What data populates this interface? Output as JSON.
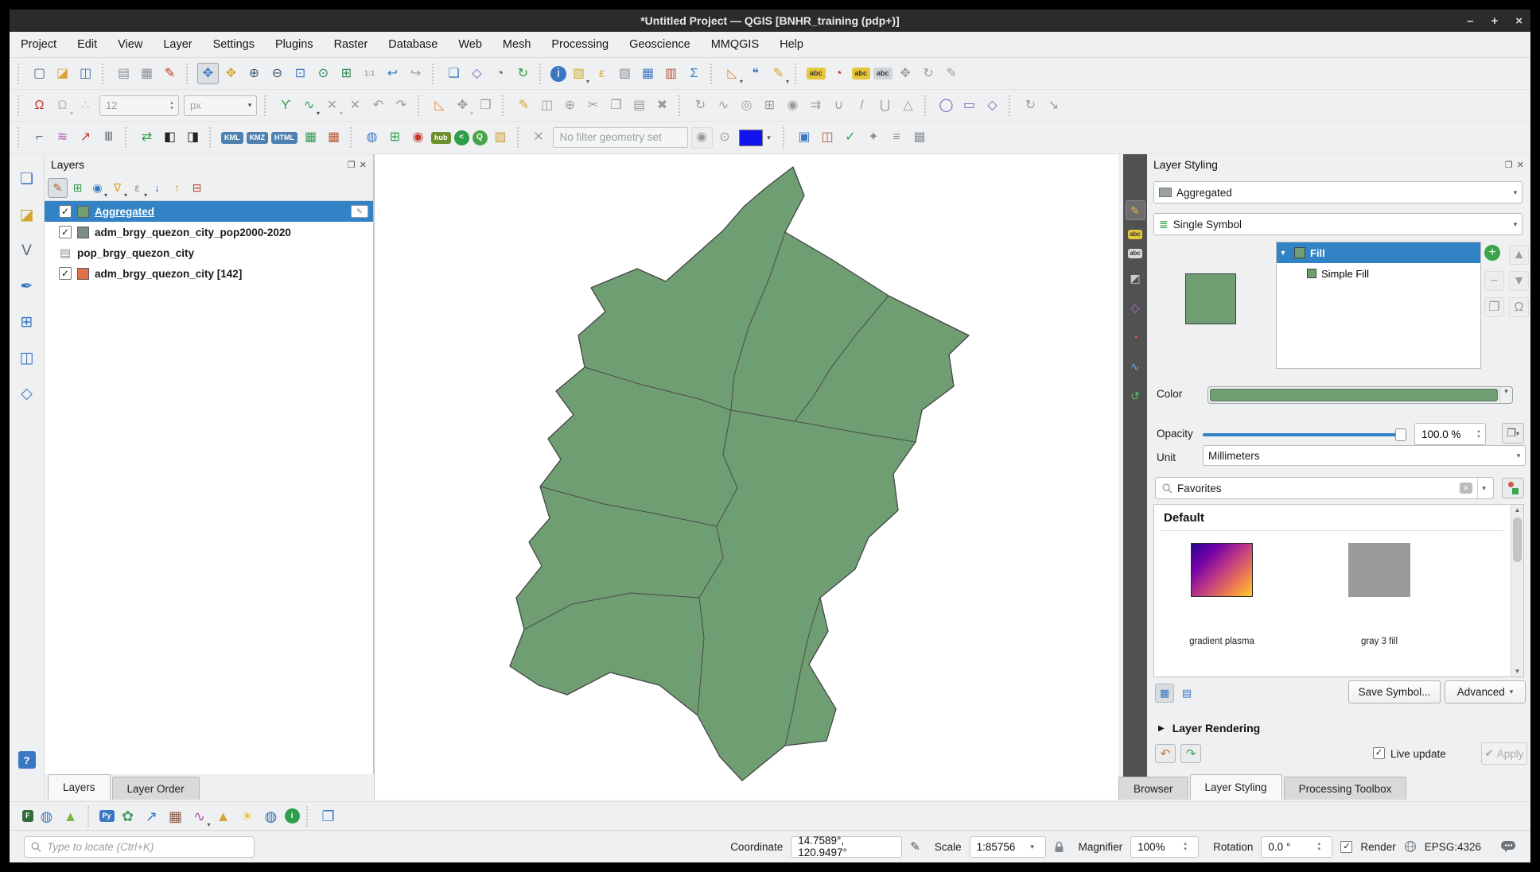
{
  "window": {
    "title": "*Untitled Project — QGIS [BNHR_training (pdp+)]",
    "controls": [
      {
        "n": "minimize-button",
        "g": "–"
      },
      {
        "n": "maximize-button",
        "g": "+"
      },
      {
        "n": "close-button",
        "g": "×"
      }
    ]
  },
  "menubar": {
    "items": [
      "Project",
      "Edit",
      "View",
      "Layer",
      "Settings",
      "Plugins",
      "Raster",
      "Database",
      "Web",
      "Mesh",
      "Processing",
      "Geoscience",
      "MMQGIS",
      "Help"
    ]
  },
  "toolbars": {
    "row1": [
      {
        "t": "sep",
        "n": "toolbar-handle"
      },
      {
        "n": "new-project-icon",
        "g": "▢",
        "c": "#5b6770"
      },
      {
        "n": "open-project-icon",
        "g": "◪",
        "c": "#d9a33c"
      },
      {
        "n": "save-project-icon",
        "g": "◫",
        "c": "#3a6fae"
      },
      {
        "t": "sep",
        "n": "toolbar-separator"
      },
      {
        "n": "new-print-layout-icon",
        "g": "▤",
        "c": "#8a9096"
      },
      {
        "n": "layout-manager-icon",
        "g": "▦",
        "c": "#8a9096"
      },
      {
        "n": "style-manager-icon",
        "g": "✎",
        "c": "#c0392b"
      },
      {
        "t": "sep",
        "n": "toolbar-separator"
      },
      {
        "n": "pan-map-icon",
        "g": "✥",
        "c": "#3b78c2",
        "on": true
      },
      {
        "n": "pan-to-selection-icon",
        "g": "✥",
        "c": "#d4a72c"
      },
      {
        "n": "zoom-in-icon",
        "g": "⊕",
        "c": "#3b5a74"
      },
      {
        "n": "zoom-out-icon",
        "g": "⊖",
        "c": "#3b5a74"
      },
      {
        "n": "zoom-full-icon",
        "g": "⊡",
        "c": "#3b78c2"
      },
      {
        "n": "zoom-to-selection-icon",
        "g": "⊙",
        "c": "#2e8b57"
      },
      {
        "n": "zoom-to-layer-icon",
        "g": "⊞",
        "c": "#2e8b57"
      },
      {
        "n": "zoom-native-icon",
        "g": "1:1",
        "d": true
      },
      {
        "n": "zoom-last-icon",
        "g": "↩",
        "c": "#3b78c2"
      },
      {
        "n": "zoom-next-icon",
        "g": "↪",
        "d": true
      },
      {
        "t": "sep",
        "n": "toolbar-separator"
      },
      {
        "n": "new-map-view-icon",
        "g": "❏",
        "c": "#3b78c2"
      },
      {
        "n": "new-3d-map-view-icon",
        "g": "◇",
        "c": "#7a5fb5"
      },
      {
        "n": "temporal-controller-icon",
        "g": "◔",
        "c": "#5b6770"
      },
      {
        "n": "refresh-map-icon",
        "g": "↻",
        "c": "#2e9e4b"
      },
      {
        "t": "sep",
        "n": "toolbar-separator"
      },
      {
        "n": "identify-features-icon",
        "g": "i",
        "bg": "#3b78c2",
        "c": "#ffffff"
      },
      {
        "n": "select-features-icon",
        "g": "▧",
        "c": "#d4a72c",
        "dd": true
      },
      {
        "n": "select-by-expression-icon",
        "g": "ε",
        "c": "#d4a72c"
      },
      {
        "n": "deselect-features-icon",
        "g": "▧",
        "c": "#8a9096"
      },
      {
        "n": "open-attribute-table-icon",
        "g": "▦",
        "c": "#3b78c2"
      },
      {
        "n": "field-calculator-icon",
        "g": "▥",
        "c": "#b3593a"
      },
      {
        "n": "statistical-summary-icon",
        "g": "Σ",
        "c": "#3b78c2"
      },
      {
        "t": "sep",
        "n": "toolbar-separator"
      },
      {
        "n": "measure-line-icon",
        "g": "◺",
        "c": "#e8913c",
        "dd": true
      },
      {
        "n": "map-tips-icon",
        "g": "❝",
        "c": "#3b78c2"
      },
      {
        "n": "new-annotation-icon",
        "g": "✎",
        "c": "#d4a72c",
        "dd": true
      },
      {
        "t": "sep",
        "n": "toolbar-separator"
      },
      {
        "n": "layer-labeling-icon",
        "t": "badge",
        "g": "abc",
        "c": "#e7c63a",
        "tc": "#333333"
      },
      {
        "n": "layer-diagram-icon",
        "g": "◔",
        "c": "#c0392b"
      },
      {
        "n": "pin-labels-icon",
        "t": "badge",
        "g": "abc",
        "c": "#e7c63a",
        "tc": "#333333"
      },
      {
        "n": "highlight-labels-icon",
        "t": "badge",
        "g": "abc",
        "c": "#cfd3d6",
        "tc": "#333333"
      },
      {
        "n": "move-label-icon",
        "g": "✥",
        "d": true
      },
      {
        "n": "rotate-label-icon",
        "g": "↻",
        "d": true
      },
      {
        "n": "change-label-icon",
        "g": "✎",
        "d": true
      }
    ],
    "row2": [
      {
        "t": "sep",
        "n": "toolbar-handle"
      },
      {
        "n": "snapping-toggle-icon",
        "g": "Ω",
        "c": "#c0392b"
      },
      {
        "n": "snapping-options-icon",
        "g": "Ω",
        "c": "#c0392b",
        "d": true,
        "dd": true
      },
      {
        "n": "snap-on-intersection-icon",
        "g": "∴",
        "c": "#5b6770",
        "d": true
      },
      {
        "n": "digitize-size-spinbox",
        "t": "spin",
        "g": "12",
        "d": true
      },
      {
        "n": "digitize-unit-combo",
        "t": "combo",
        "g": "px",
        "d": true
      },
      {
        "t": "sep",
        "n": "toolbar-separator"
      },
      {
        "n": "tracing-icon",
        "g": "ϒ",
        "c": "#2e9e4b"
      },
      {
        "n": "digitize-with-curve-icon",
        "g": "∿",
        "c": "#2e9e4b",
        "dd": true
      },
      {
        "n": "vertex-tool-icon",
        "g": "✕",
        "d": true,
        "dd": true
      },
      {
        "n": "vertex-tool-current-icon",
        "g": "✕",
        "d": true
      },
      {
        "n": "undo-edit-icon",
        "g": "↶",
        "d": true
      },
      {
        "n": "redo-edit-icon",
        "g": "↷",
        "d": true
      },
      {
        "t": "sep",
        "n": "toolbar-separator"
      },
      {
        "n": "measure-angle-icon",
        "g": "◺",
        "c": "#e8913c"
      },
      {
        "n": "move-feature-icon",
        "g": "✥",
        "d": true,
        "dd": true
      },
      {
        "n": "copy-move-feature-icon",
        "g": "❐",
        "d": true
      },
      {
        "t": "sep",
        "n": "toolbar-separator"
      },
      {
        "n": "toggle-editing-icon",
        "g": "✎",
        "c": "#d4a72c"
      },
      {
        "n": "save-edits-icon",
        "g": "◫",
        "d": true
      },
      {
        "n": "add-feature-icon",
        "g": "⊕",
        "d": true
      },
      {
        "n": "cut-features-icon",
        "g": "✂",
        "d": true
      },
      {
        "n": "copy-features-icon",
        "g": "❐",
        "d": true
      },
      {
        "n": "paste-features-icon",
        "g": "▤",
        "d": true
      },
      {
        "n": "delete-selected-icon",
        "g": "✖",
        "d": true
      },
      {
        "t": "sep",
        "n": "toolbar-separator"
      },
      {
        "n": "rotate-feature-icon",
        "g": "↻",
        "d": true
      },
      {
        "n": "simplify-feature-icon",
        "g": "∿",
        "d": true
      },
      {
        "n": "add-ring-icon",
        "g": "◎",
        "d": true
      },
      {
        "n": "add-part-icon",
        "g": "⊞",
        "d": true
      },
      {
        "n": "fill-ring-icon",
        "g": "◉",
        "d": true
      },
      {
        "n": "offset-curve-icon",
        "g": "⇉",
        "d": true
      },
      {
        "n": "reshape-features-icon",
        "g": "∪",
        "d": true
      },
      {
        "n": "split-features-icon",
        "g": "/",
        "d": true
      },
      {
        "n": "merge-features-icon",
        "g": "⋃",
        "d": true
      },
      {
        "n": "vertex-digitizing-icon",
        "g": "△",
        "d": true
      },
      {
        "t": "sep",
        "n": "toolbar-separator"
      },
      {
        "n": "shape-circle-icon",
        "g": "◯",
        "c": "#7a5fb5"
      },
      {
        "n": "shape-rectangle-icon",
        "g": "▭",
        "c": "#7a5fb5"
      },
      {
        "n": "shape-polygon-icon",
        "g": "◇",
        "c": "#7a5fb5"
      },
      {
        "t": "sep",
        "n": "toolbar-separator"
      },
      {
        "n": "rotate-point-symbols-icon",
        "g": "↻",
        "d": true
      },
      {
        "n": "offset-point-symbols-icon",
        "g": "↘",
        "d": true
      }
    ],
    "row3": [
      {
        "t": "sep",
        "n": "toolbar-handle"
      },
      {
        "n": "line-style-icon",
        "g": "⌐",
        "c": "#5b6770"
      },
      {
        "n": "colored-lines-icon",
        "g": "≋",
        "c": "#b05ab0"
      },
      {
        "n": "red-polyline-icon",
        "g": "↗",
        "c": "#c0392b"
      },
      {
        "n": "hatch-lines-icon",
        "g": "Ⅲ",
        "c": "#5b6770"
      },
      {
        "t": "sep",
        "n": "toolbar-separator"
      },
      {
        "n": "swap-arrows-icon",
        "g": "⇄",
        "c": "#2e9e4b"
      },
      {
        "n": "bw-raster-left-icon",
        "g": "◧",
        "c": "#222222"
      },
      {
        "n": "bw-raster-right-icon",
        "g": "◨",
        "c": "#222222"
      },
      {
        "t": "sep",
        "n": "toolbar-separator"
      },
      {
        "n": "export-kml-icon",
        "t": "badge",
        "g": "KML",
        "c": "#4f81b0"
      },
      {
        "n": "export-kmz-icon",
        "t": "badge",
        "g": "KMZ",
        "c": "#4f81b0"
      },
      {
        "n": "export-html-icon",
        "t": "badge",
        "g": "HTML",
        "c": "#4f81b0"
      },
      {
        "n": "raster-palette-icon",
        "g": "▦",
        "c": "#2e9e4b"
      },
      {
        "n": "raster-palette-2-icon",
        "g": "▦",
        "c": "#b3593a"
      },
      {
        "t": "sep",
        "n": "toolbar-separator"
      },
      {
        "n": "quickmapservices-icon",
        "g": "◍",
        "c": "#3b78c2"
      },
      {
        "n": "add-grid-icon",
        "g": "⊞",
        "c": "#2e9e4b"
      },
      {
        "n": "philippines-data-icon",
        "g": "◉",
        "c": "#c0392b"
      },
      {
        "n": "qgis-hub-icon",
        "t": "badge",
        "g": "hub",
        "c": "#6f8f2f"
      },
      {
        "n": "share-icon",
        "t": "badge",
        "g": "<",
        "c": "#2e9e4b",
        "round": true
      },
      {
        "n": "search-layers-icon",
        "t": "badge",
        "g": "Q",
        "c": "#4aa54a",
        "round": true
      },
      {
        "n": "osm-edit-icon",
        "g": "▨",
        "c": "#c8a23c"
      },
      {
        "t": "sep",
        "n": "toolbar-separator"
      },
      {
        "n": "clear-geometry-filter-icon",
        "g": "✕",
        "d": true
      },
      {
        "n": "geometry-filter-field",
        "t": "field",
        "g": "No filter geometry set"
      },
      {
        "n": "show-filter-eye-icon",
        "g": "◉",
        "d": true,
        "framed": true
      },
      {
        "n": "zoom-filter-icon",
        "g": "⊙",
        "d": true
      },
      {
        "n": "mask-color-swatch",
        "t": "swatch",
        "c": "#1212ee"
      },
      {
        "t": "sep",
        "n": "toolbar-separator"
      },
      {
        "n": "draw-extent-icon",
        "g": "▣",
        "c": "#3b78c2"
      },
      {
        "n": "group-stats-icon",
        "g": "◫",
        "c": "#b3593a"
      },
      {
        "n": "check-geometry-icon",
        "g": "✓",
        "c": "#2e9e4b"
      },
      {
        "n": "topology-checker-icon",
        "g": "✦",
        "c": "#8a9096"
      },
      {
        "n": "layers-stack-icon",
        "g": "≡",
        "c": "#8a9096"
      },
      {
        "n": "data-table-icon",
        "g": "▦",
        "c": "#8a9096"
      }
    ]
  },
  "left_toolbar": [
    {
      "n": "data-source-manager-icon",
      "g": "❏",
      "c": "#3b78c2"
    },
    {
      "n": "add-raster-layer-icon",
      "g": "◪",
      "c": "#d4a72c"
    },
    {
      "n": "add-vector-layer-icon",
      "g": "V",
      "c": "#5b6770"
    },
    {
      "n": "add-spatialite-layer-icon",
      "g": "✒",
      "c": "#3b78c2"
    },
    {
      "n": "add-mesh-layer-icon",
      "g": "⊞",
      "c": "#3b78c2"
    },
    {
      "n": "add-wms-layer-icon",
      "g": "◫",
      "c": "#3b78c2"
    },
    {
      "n": "add-virtual-layer-icon",
      "g": "◇",
      "c": "#3b78c2"
    },
    {
      "n": "help-icon",
      "t": "badge",
      "g": "?",
      "c": "#3b78c2",
      "gap": true
    }
  ],
  "layers_panel": {
    "title": "Layers",
    "toolbar": [
      {
        "n": "open-layer-styling-icon",
        "g": "✎",
        "c": "#b3593a",
        "on": true
      },
      {
        "n": "add-group-icon",
        "g": "⊞",
        "c": "#2e9e4b"
      },
      {
        "n": "manage-map-themes-icon",
        "g": "◉",
        "c": "#3b78c2",
        "dd": true
      },
      {
        "n": "filter-legend-icon",
        "g": "∇",
        "c": "#d4a72c",
        "dd": true
      },
      {
        "n": "filter-by-expression-icon",
        "g": "ε",
        "c": "#8a9096",
        "dd": true
      },
      {
        "n": "expand-all-icon",
        "g": "↓",
        "c": "#3b78c2"
      },
      {
        "n": "collapse-all-icon",
        "g": "↑",
        "c": "#d4a72c"
      },
      {
        "n": "remove-layer-icon",
        "g": "⊟",
        "c": "#c0392b"
      }
    ],
    "layers": [
      {
        "label": "Aggregated",
        "type": "vector",
        "checked": true,
        "swatch": "#6f9e72",
        "selected": true,
        "edit": true
      },
      {
        "label": "adm_brgy_quezon_city_pop2000-2020",
        "type": "vector",
        "checked": true,
        "swatch": "#7d8c8a"
      },
      {
        "label": "pop_brgy_quezon_city",
        "type": "table"
      },
      {
        "label": "adm_brgy_quezon_city [142]",
        "type": "vector",
        "checked": true,
        "swatch": "#e2704a"
      }
    ],
    "tabs": [
      {
        "label": "Layers",
        "active": true
      },
      {
        "label": "Layer Order",
        "active": false
      }
    ]
  },
  "map": {
    "fill_color": "#6f9e72",
    "outline_color": "#454545"
  },
  "styling_panel": {
    "title": "Layer Styling",
    "dock_icons": [
      {
        "n": "dock-float-icon",
        "g": "❐",
        "c": "#555555"
      },
      {
        "n": "dock-close-icon",
        "g": "✕",
        "c": "#555555"
      }
    ],
    "strip": [
      {
        "n": "symbology-tab-icon",
        "g": "✎",
        "c": "#e0b13c",
        "on": true
      },
      {
        "n": "labels-tab-icon",
        "t": "badge",
        "g": "abc",
        "c": "#e7c63a",
        "tc": "#333333"
      },
      {
        "n": "callouts-tab-icon",
        "t": "badge",
        "g": "abc",
        "c": "#d8dadc",
        "tc": "#333333"
      },
      {
        "n": "mask-tab-icon",
        "g": "◩",
        "c": "#c9cdd0"
      },
      {
        "n": "view-3d-tab-icon",
        "g": "◇",
        "c": "#b07ad0"
      },
      {
        "n": "diagrams-tab-icon",
        "g": "◔",
        "c": "#d05a4a"
      },
      {
        "n": "elevation-tab-icon",
        "g": "∿",
        "c": "#6fa8e0"
      },
      {
        "n": "history-tab-icon",
        "g": "↺",
        "c": "#58c06a"
      }
    ],
    "layer_selector": "Aggregated",
    "renderer": "Single Symbol",
    "symbol_tree": {
      "root_label": "Fill",
      "child_label": "Simple Fill"
    },
    "symbol_buttons": [
      {
        "n": "add-symbol-layer-button",
        "g": "+",
        "bg": "#3aa54a",
        "c": "#ffffff"
      },
      {
        "n": "move-up-symbol-button",
        "g": "▲",
        "d": true,
        "framed": true
      },
      {
        "n": "remove-symbol-layer-button",
        "g": "−",
        "d": true,
        "framed": true
      },
      {
        "n": "move-down-symbol-button",
        "g": "▼",
        "d": true,
        "framed": true
      },
      {
        "n": "duplicate-symbol-layer-button",
        "g": "❐",
        "d": true,
        "framed": true
      },
      {
        "n": "lock-symbol-color-button",
        "g": "Ω",
        "d": true,
        "framed": true
      }
    ],
    "color_label": "Color",
    "color_value": "#6f9e72",
    "opacity_label": "Opacity",
    "opacity_value": "100.0 %",
    "unit_label": "Unit",
    "unit_value": "Millimeters",
    "search_value": "Favorites",
    "group_header": "Default",
    "symbols": [
      {
        "caption": "gradient plasma",
        "kind": "plasma"
      },
      {
        "caption": "gray 3 fill",
        "kind": "gray"
      }
    ],
    "save_symbol_label": "Save Symbol...",
    "advanced_label": "Advanced",
    "layer_rendering_label": "Layer Rendering",
    "live_update_label": "Live update",
    "apply_label": "Apply",
    "tabs": [
      {
        "label": "Browser",
        "active": false
      },
      {
        "label": "Layer Styling",
        "active": true
      },
      {
        "label": "Processing Toolbox",
        "active": false
      }
    ]
  },
  "plugins_toolbar": [
    {
      "n": "plugin-f-icon",
      "t": "badge",
      "g": "F",
      "c": "#2f6b3a"
    },
    {
      "n": "plugin-globe-icon",
      "g": "◍",
      "c": "#3b78c2"
    },
    {
      "n": "plugin-delta-icon",
      "g": "▲",
      "c": "#7ab648"
    },
    {
      "t": "sep",
      "n": "toolbar-separator"
    },
    {
      "n": "python-console-icon",
      "t": "badge",
      "g": "Py",
      "c": "#3b78c2"
    },
    {
      "n": "plugin-leaf-icon",
      "g": "✿",
      "c": "#4a9a6a"
    },
    {
      "n": "plot-builder-icon",
      "g": "↗",
      "c": "#3b78c2"
    },
    {
      "n": "raster-table-icon",
      "g": "▦",
      "c": "#8a5a4a"
    },
    {
      "n": "profile-curves-icon",
      "g": "∿",
      "c": "#b05ab0",
      "dd": true
    },
    {
      "n": "surface-3d-icon",
      "g": "▲",
      "c": "#d4a72c"
    },
    {
      "n": "polygon-sun-icon",
      "g": "☀",
      "c": "#e8c53c"
    },
    {
      "n": "earth-icon",
      "g": "◍",
      "c": "#2e6bb0"
    },
    {
      "n": "metadata-info-icon",
      "t": "badge",
      "g": "i",
      "c": "#2e9e4b",
      "round": true
    },
    {
      "t": "sep",
      "n": "toolbar-separator"
    },
    {
      "n": "copy-canvas-icon",
      "g": "❐",
      "c": "#3b78c2"
    }
  ],
  "statusbar": {
    "locator_placeholder": "Type to locate (Ctrl+K)",
    "coordinate_label": "Coordinate",
    "coordinate_value": "14.7589°, 120.9497°",
    "scale_label": "Scale",
    "scale_value": "1:85756",
    "magnifier_label": "Magnifier",
    "magnifier_value": "100%",
    "rotation_label": "Rotation",
    "rotation_value": "0.0 °",
    "render_label": "Render",
    "crs_value": "EPSG:4326"
  }
}
